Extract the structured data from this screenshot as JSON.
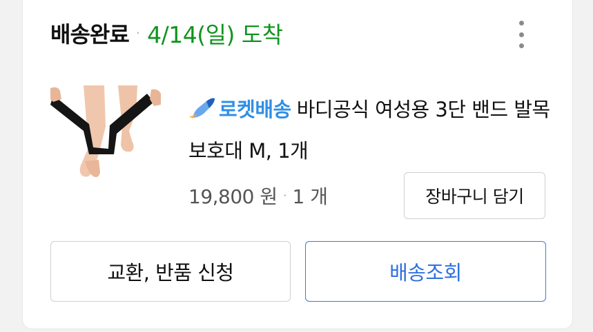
{
  "order": {
    "status": "배송완료",
    "separator": "·",
    "arrival": "4/14(일) 도착"
  },
  "product": {
    "badge": "로켓배송",
    "name": "바디공식 여성용 3단 밴드 발목보호대 M, 1개",
    "price": "19,800 원",
    "price_separator": "·",
    "quantity": "1 개",
    "image_desc_icon": "ankle-brace-photo"
  },
  "actions": {
    "add_to_cart": "장바구니 담기",
    "exchange_return": "교환, 반품 신청",
    "track_delivery": "배송조회"
  },
  "colors": {
    "arrival": "#11941f",
    "rocket": "#2e8fe8",
    "track_button": "#2e6fe0"
  },
  "icons": {
    "more": "more-vertical-icon",
    "rocket": "rocket-icon"
  }
}
